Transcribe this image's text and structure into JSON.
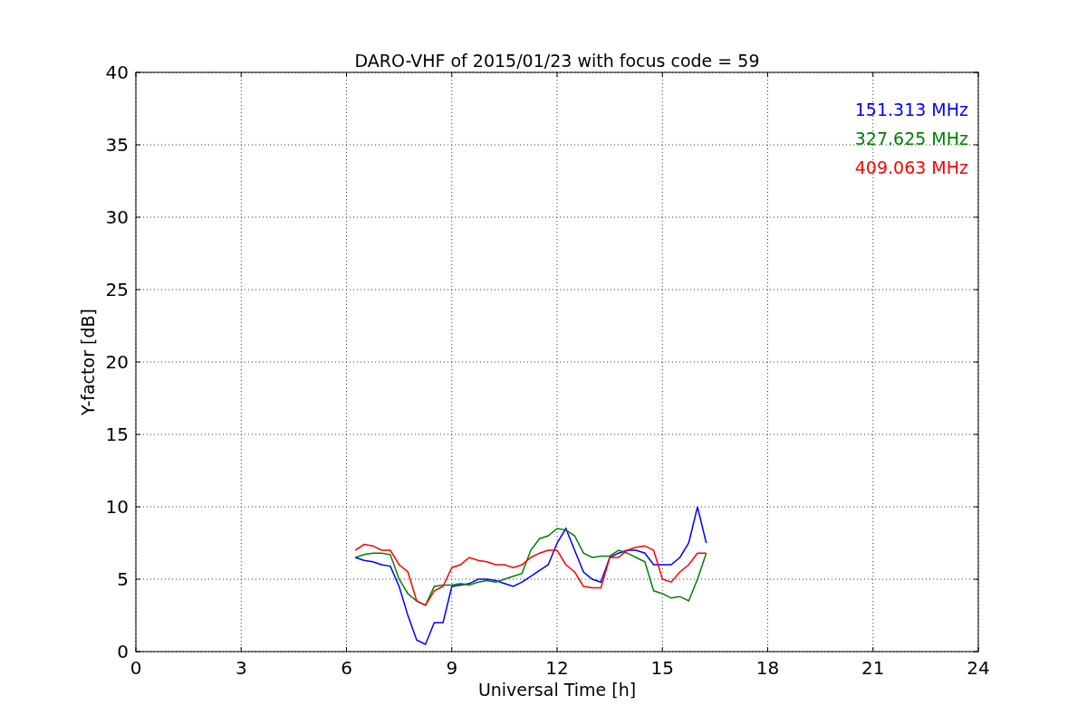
{
  "figure": {
    "chart_data": {
      "type": "line",
      "title": "DARO-VHF of 2015/01/23 with focus code = 59",
      "xlabel": "Universal Time [h]",
      "ylabel": "Y-factor [dB]",
      "x": [
        6.25,
        6.5,
        6.75,
        7.0,
        7.25,
        7.5,
        7.75,
        8.0,
        8.25,
        8.5,
        8.75,
        9.0,
        9.25,
        9.5,
        9.75,
        10.0,
        10.25,
        10.5,
        10.75,
        11.0,
        11.25,
        11.5,
        11.75,
        12.0,
        12.25,
        12.5,
        12.75,
        13.0,
        13.25,
        13.5,
        13.75,
        14.0,
        14.25,
        14.5,
        14.75,
        15.0,
        15.25,
        15.5,
        15.75,
        16.0,
        16.25
      ],
      "series": [
        {
          "name": "151.313 MHz",
          "color": "#0000ff",
          "values": [
            6.5,
            6.3,
            6.2,
            6.0,
            5.9,
            4.5,
            2.5,
            0.8,
            0.5,
            2.0,
            2.0,
            4.5,
            4.6,
            4.7,
            5.0,
            5.0,
            4.9,
            4.7,
            4.5,
            4.8,
            5.2,
            5.6,
            6.0,
            7.5,
            8.5,
            7.0,
            5.5,
            5.0,
            4.8,
            6.5,
            6.8,
            7.0,
            7.0,
            6.8,
            6.0,
            6.0,
            6.0,
            6.5,
            7.5,
            10.0,
            7.5
          ]
        },
        {
          "name": "327.625 MHz",
          "color": "#008000",
          "values": [
            6.5,
            6.7,
            6.8,
            6.8,
            6.7,
            5.0,
            4.0,
            3.5,
            3.2,
            4.5,
            4.6,
            4.6,
            4.7,
            4.6,
            4.8,
            4.9,
            4.8,
            5.0,
            5.2,
            5.4,
            7.0,
            7.8,
            8.0,
            8.5,
            8.4,
            8.0,
            6.8,
            6.5,
            6.6,
            6.6,
            7.0,
            6.8,
            6.5,
            6.2,
            4.2,
            4.0,
            3.7,
            3.8,
            3.5,
            5.0,
            6.8
          ]
        },
        {
          "name": "409.063 MHz",
          "color": "#ff0000",
          "values": [
            7.0,
            7.4,
            7.3,
            7.0,
            7.0,
            6.0,
            5.5,
            3.5,
            3.2,
            4.2,
            4.5,
            5.8,
            6.0,
            6.5,
            6.3,
            6.2,
            6.0,
            6.0,
            5.8,
            6.0,
            6.5,
            6.8,
            7.0,
            7.0,
            6.0,
            5.5,
            4.5,
            4.4,
            4.4,
            6.5,
            6.5,
            7.0,
            7.2,
            7.3,
            7.0,
            5.0,
            4.8,
            5.5,
            6.0,
            6.8,
            6.8
          ]
        }
      ],
      "xlim": [
        0,
        24
      ],
      "ylim": [
        0,
        40
      ],
      "xticks": [
        0,
        3,
        6,
        9,
        12,
        15,
        18,
        21,
        24
      ],
      "yticks": [
        0,
        5,
        10,
        15,
        20,
        25,
        30,
        35,
        40
      ],
      "grid": true
    }
  }
}
